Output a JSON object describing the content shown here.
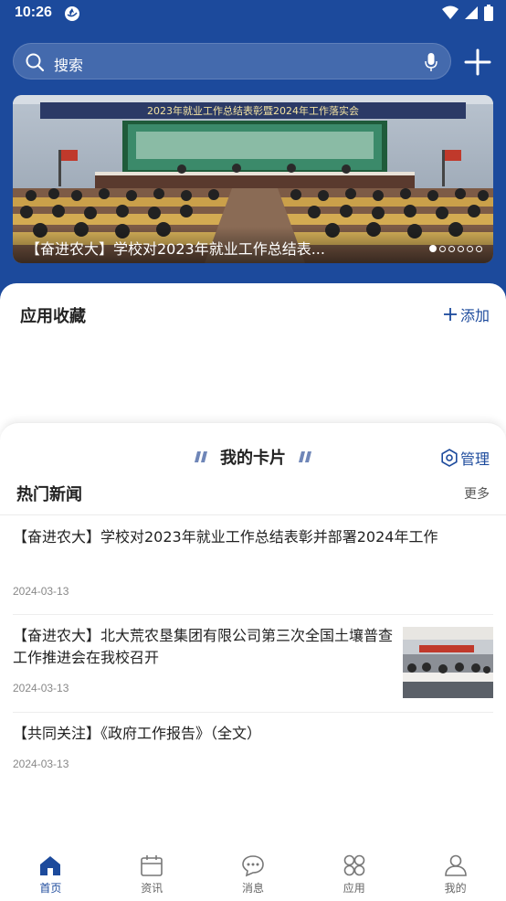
{
  "status_bar": {
    "time": "10:26"
  },
  "header": {
    "search_placeholder": "搜索",
    "banner": {
      "caption": "【奋进农大】学校对2023年就业工作总结表...",
      "slide_count": 6,
      "active_slide": 1,
      "backdrop_text": "2023年就业工作总结表彰暨2024年工作落实会"
    }
  },
  "favorites": {
    "title": "应用收藏",
    "add_label": "添加"
  },
  "cards": {
    "title": "我的卡片",
    "manage_label": "管理",
    "hot_news": {
      "title": "热门新闻",
      "more_label": "更多",
      "items": [
        {
          "title": "【奋进农大】学校对2023年就业工作总结表彰并部署2024年工作",
          "date": "2024-03-13"
        },
        {
          "title": "【奋进农大】北大荒农垦集团有限公司第三次全国土壤普查工作推进会在我校召开",
          "date": "2024-03-13"
        },
        {
          "title": "【共同关注】《政府工作报告》（全文）",
          "date": "2024-03-13"
        }
      ]
    }
  },
  "bottom_nav": {
    "items": [
      {
        "label": "首页",
        "icon": "home-icon"
      },
      {
        "label": "资讯",
        "icon": "calendar-icon"
      },
      {
        "label": "消息",
        "icon": "chat-bubble-icon"
      },
      {
        "label": "应用",
        "icon": "apps-grid-icon"
      },
      {
        "label": "我的",
        "icon": "person-icon"
      }
    ],
    "active_index": 0
  },
  "colors": {
    "primary": "#1c4a9c",
    "text": "#222222",
    "muted": "#888888"
  }
}
